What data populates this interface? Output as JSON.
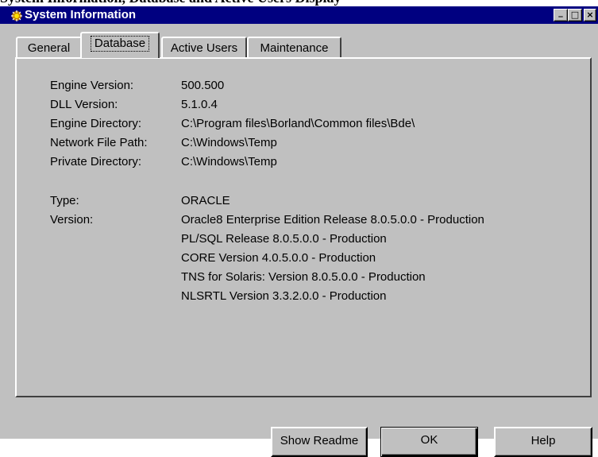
{
  "header_strip": "System Information, Database and Active Users Display",
  "window": {
    "title": "System Information",
    "controls": {
      "minimize": "_",
      "maximize": "□",
      "close": "×"
    }
  },
  "tabs": [
    {
      "label": "General",
      "active": false
    },
    {
      "label": "Database",
      "active": true
    },
    {
      "label": "Active Users",
      "active": false
    },
    {
      "label": "Maintenance",
      "active": false
    }
  ],
  "info": {
    "engine_version": {
      "label": "Engine Version:",
      "value": "500.500"
    },
    "dll_version": {
      "label": "DLL Version:",
      "value": "5.1.0.4"
    },
    "engine_directory": {
      "label": "Engine Directory:",
      "value": "C:\\Program files\\Borland\\Common files\\Bde\\"
    },
    "network_file_path": {
      "label": "Network File Path:",
      "value": "C:\\Windows\\Temp"
    },
    "private_directory": {
      "label": "Private Directory:",
      "value": "C:\\Windows\\Temp"
    },
    "type": {
      "label": "Type:",
      "value": "ORACLE"
    },
    "version": {
      "label": "Version:",
      "lines": [
        "Oracle8 Enterprise Edition Release 8.0.5.0.0 - Production",
        "PL/SQL Release 8.0.5.0.0 - Production",
        "CORE Version 4.0.5.0.0 - Production",
        "TNS for Solaris: Version 8.0.5.0.0 - Production",
        "NLSRTL Version 3.3.2.0.0 - Production"
      ]
    }
  },
  "buttons": {
    "show_readme": "Show Readme",
    "ok": "OK",
    "help": "Help"
  },
  "colors": {
    "titlebar": "#000080",
    "face": "#c0c0c0"
  }
}
